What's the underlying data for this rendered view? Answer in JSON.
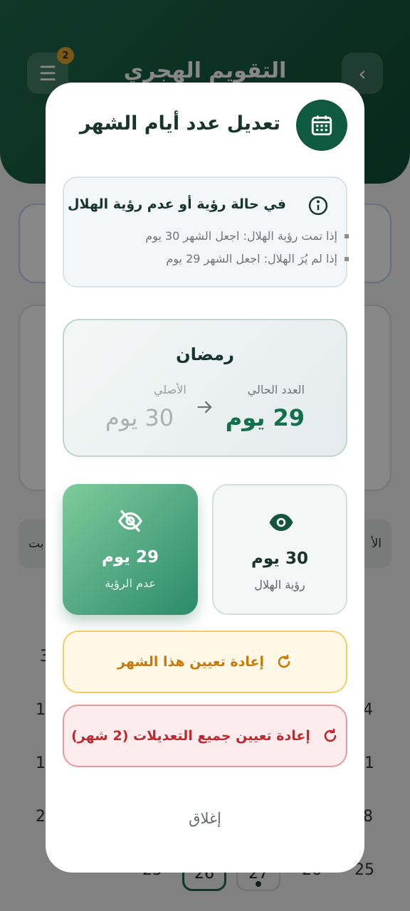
{
  "background": {
    "header_title": "التقويم الهجري",
    "filter_badge": "2",
    "weekday_left": "بت",
    "weekday_right": "الأ",
    "days_left": [
      "3",
      "1",
      "1",
      "2",
      "25"
    ],
    "days_right": [
      "4",
      "1",
      "8",
      "25"
    ],
    "selected_day": "26",
    "dot_day": "27",
    "day_after": "26"
  },
  "dialog": {
    "title": "تعديل عدد أيام الشهر",
    "icon": "calendar-icon",
    "info": {
      "title": "في حالة رؤية أو عدم رؤية الهلال",
      "line1": "إذا تمت رؤية الهلال: اجعل الشهر 30 يوم",
      "line2": "إذا لم يُرَ الهلال: اجعل الشهر 29 يوم"
    },
    "month": {
      "name": "رمضان",
      "current_label": "العدد الحالي",
      "current_value": "29 يوم",
      "original_label": "الأصلي",
      "original_value": "30 يوم"
    },
    "options": {
      "visible": {
        "days": "30 يوم",
        "label": "رؤية الهلال",
        "icon": "eye-icon"
      },
      "not_visible": {
        "days": "29 يوم",
        "label": "عدم الرؤية",
        "icon": "eye-off-icon",
        "selected": true
      }
    },
    "reset_month_label": "إعادة تعيين هذا الشهر",
    "reset_all_label": "إعادة تعيين جميع التعديلات (2 شهر)",
    "close_label": "إغلاق"
  },
  "colors": {
    "primary": "#0f5a41",
    "accent_green": "#12704c",
    "warning": "#c8790a",
    "danger": "#c0282e"
  }
}
